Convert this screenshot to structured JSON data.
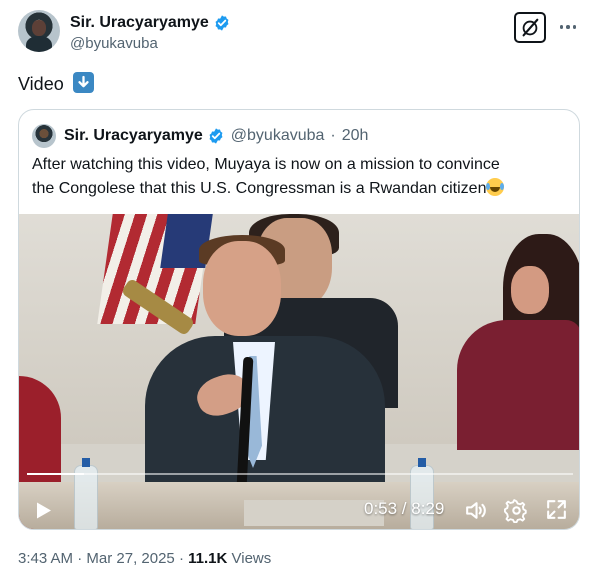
{
  "author": {
    "name": "Sir. Uracyaryamye",
    "handle": "@byukavuba"
  },
  "tweet": {
    "text": "Video"
  },
  "quoted": {
    "name": "Sir. Uracyaryamye",
    "handle": "@byukavuba",
    "separator": "·",
    "age": "20h",
    "text_line_1": "After watching this video, Muyaya is now on a mission to convince",
    "text_line_2": "the Congolese that this U.S. Congressman is a Rwandan citizen"
  },
  "video": {
    "current_time": "0:53",
    "duration": "8:29",
    "time_display": "0:53 / 8:29",
    "progress_fraction": 0.104
  },
  "footer": {
    "time": "3:43 AM",
    "separator": "·",
    "date": "Mar 27, 2025",
    "views_count": "11.1K",
    "views_label": "Views"
  },
  "icons": {
    "verified": "verified-badge-icon",
    "grok": "grok-icon",
    "more": "more-icon",
    "down_arrow": "down-arrow-emoji-icon",
    "laughing": "tears-of-joy-emoji-icon",
    "play": "play-icon",
    "volume": "volume-icon",
    "settings": "settings-icon",
    "fullscreen": "fullscreen-icon"
  },
  "colors": {
    "verified_blue": "#1d9bf0",
    "muted_text": "#536471",
    "border": "#cfd9de",
    "arrow_blue": "#3b88c3"
  }
}
